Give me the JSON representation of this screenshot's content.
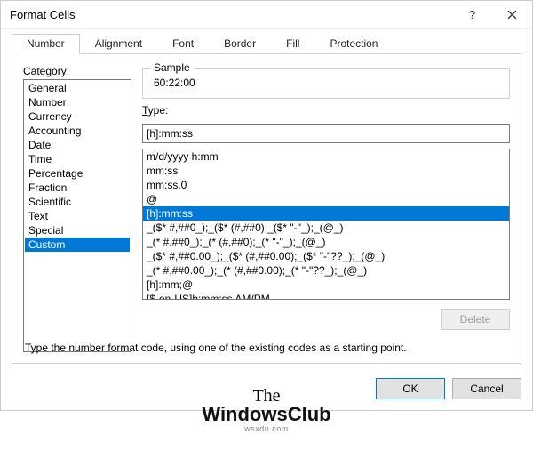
{
  "window": {
    "title": "Format Cells"
  },
  "tabs": {
    "items": [
      "Number",
      "Alignment",
      "Font",
      "Border",
      "Fill",
      "Protection"
    ],
    "active": "Number"
  },
  "category": {
    "label_pre": "C",
    "label_post": "ategory:",
    "items": [
      "General",
      "Number",
      "Currency",
      "Accounting",
      "Date",
      "Time",
      "Percentage",
      "Fraction",
      "Scientific",
      "Text",
      "Special",
      "Custom"
    ],
    "selected": "Custom"
  },
  "sample": {
    "legend": "Sample",
    "value": "60:22:00"
  },
  "type": {
    "label_pre": "T",
    "label_post": "ype:",
    "value": "[h]:mm:ss",
    "options": [
      "m/d/yyyy h:mm",
      "mm:ss",
      "mm:ss.0",
      "@",
      "[h]:mm:ss",
      "_($* #,##0_);_($* (#,##0);_($* \"-\"_);_(@_)",
      "_(* #,##0_);_(* (#,##0);_(* \"-\"_);_(@_)",
      "_($* #,##0.00_);_($* (#,##0.00);_($* \"-\"??_);_(@_)",
      "_(* #,##0.00_);_(* (#,##0.00);_(* \"-\"??_);_(@_)",
      "[h]:mm;@",
      "[$-en-US]h:mm:ss AM/PM"
    ],
    "selected": "[h]:mm:ss"
  },
  "buttons": {
    "delete": "Delete",
    "ok": "OK",
    "cancel": "Cancel"
  },
  "hint": "Type the number format code, using one of the existing codes as a starting point.",
  "watermark": {
    "line1": "The",
    "line2": "WindowsClub",
    "sub": "wsxdn.com"
  }
}
